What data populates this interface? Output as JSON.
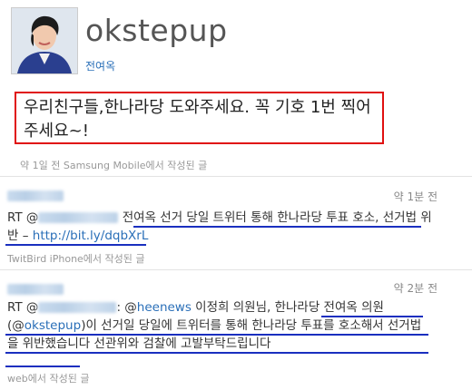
{
  "profile": {
    "handle": "okstepup",
    "realname": "전여옥"
  },
  "main_tweet": {
    "text": "우리친구들,한나라당 도와주세요. 꼭 기호 1번 찍어주세요~!",
    "meta": "약 1일 전 Samsung Mobile에서 작성된 글"
  },
  "replies": [
    {
      "time": "약 1분 전",
      "rt_prefix": "RT @",
      "text_part1": "전여옥 선거 당일 트위터 통해 한나라당 투표 호소, 선거법 위반 – ",
      "link": "http://bit.ly/dqbXrL",
      "meta": "TwitBird iPhone에서 작성된 글"
    },
    {
      "time": "약 2분 전",
      "rt_prefix": "RT @",
      "colon_prefix": ": @",
      "mention1": "heenews",
      "text_part1": " 이정희 의원님, 한나라당 전여옥 의원(@",
      "mention2": "okstepup",
      "text_part2": ")이 선거일 당일에 트위터를 통해 한나라당 투표를 호소해서 선거법을 위반했습니다 선관위와 검찰에 고발부탁드립니다",
      "meta": "web에서 작성된 글"
    }
  ],
  "colors": {
    "highlight_box": "#e01010",
    "underline": "#1a2fbf",
    "link": "#2a6fb8"
  }
}
